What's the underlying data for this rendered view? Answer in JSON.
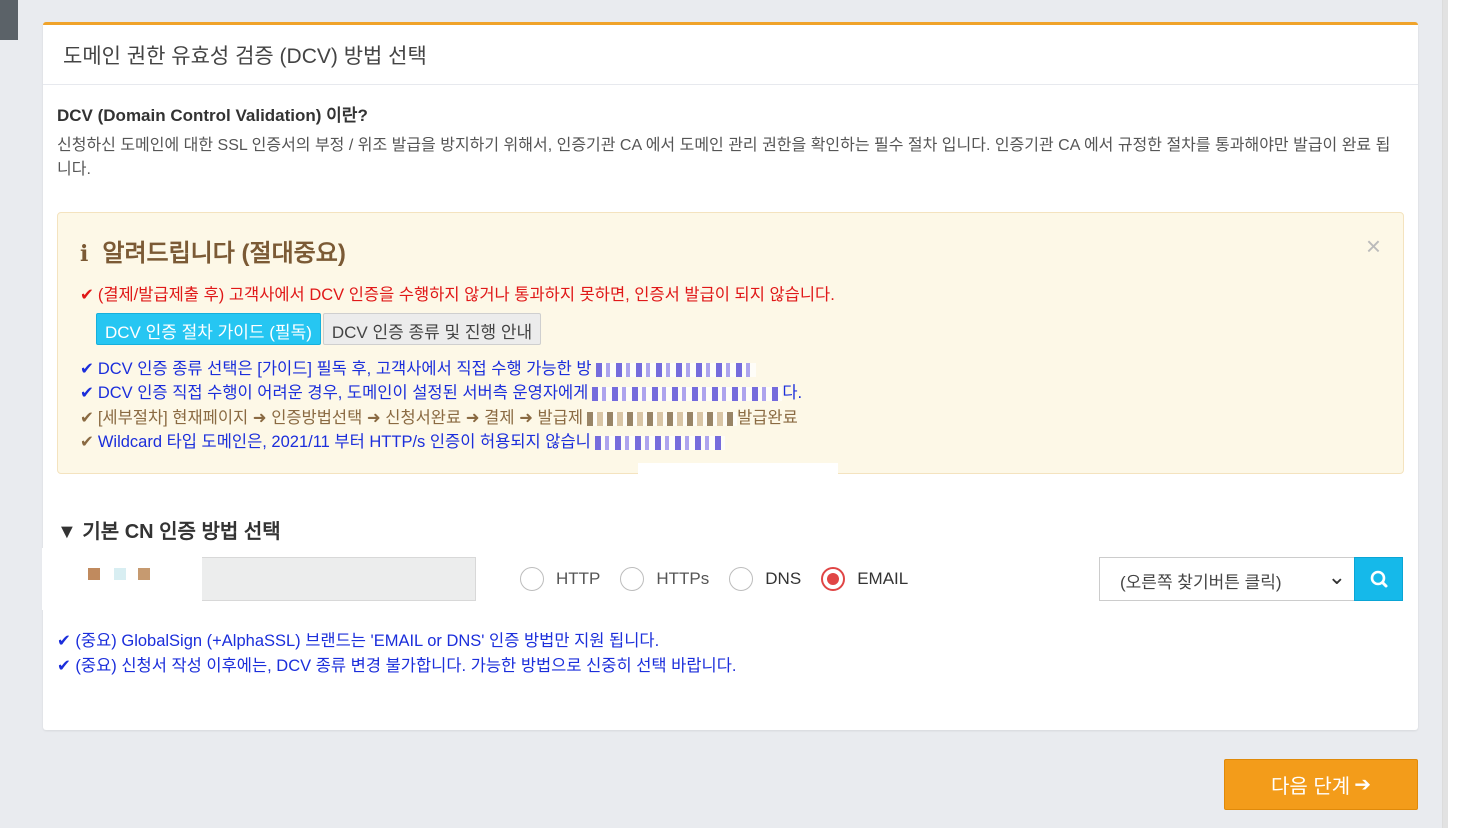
{
  "section": {
    "title": "도메인 권한 유효성 검증 (DCV) 방법 선택",
    "dcv_question": "DCV (Domain Control Validation) 이란?",
    "dcv_description": "신청하신 도메인에 대한 SSL 인증서의 부정 / 위조 발급을 방지하기 위해서, 인증기관 CA 에서 도메인 관리 권한을 확인하는 필수 절차 입니다. 인증기관 CA 에서 규정한 절차를 통과해야만 발급이 완료 됩니다."
  },
  "notice": {
    "title": "알려드립니다 (절대중요)",
    "close": "×",
    "line1": "(결제/발급제출 후) 고객사에서 DCV 인증을 수행하지 않거나 통과하지 못하면, 인증서 발급이 되지 않습니다.",
    "guide_button": "DCV 인증 절차 가이드 (필독)",
    "types_button": "DCV 인증 종류 및 진행 안내",
    "line2": "DCV 인증 종류 선택은 [가이드] 필독 후, 고객사에서 직접 수행 가능한 방",
    "line3": "DCV 인증 직접 수행이 어려운 경우, 도메인이 설정된 서버측 운영자에게",
    "line3_end": "다.",
    "line4": "[세부절차] 현재페이지 ➜ 인증방법선택 ➜ 신청서완료 ➜ 결제 ➜ 발급제",
    "line4_end": "발급완료",
    "line5": "Wildcard 타입 도메인은, 2021/11 부터 HTTP/s 인증이 허용되지 않습니"
  },
  "cn": {
    "title": "▼ 기본 CN 인증 방법 선택",
    "methods": [
      "HTTP",
      "HTTPs",
      "DNS",
      "EMAIL"
    ],
    "selected": "EMAIL",
    "select_value": "(오른쪽 찾기버튼 클릭)"
  },
  "notes": [
    "(중요) GlobalSign (+AlphaSSL) 브랜드는 'EMAIL or DNS' 인증 방법만 지원 됩니다.",
    "(중요) 신청서 작성 이후에는, DCV 종류 변경 불가합니다. 가능한 방법으로 신중히 선택 바랍니다."
  ],
  "next_button": "다음 단계",
  "colors": {
    "accent": "#f39c1a",
    "notice_red": "#e01818",
    "notice_blue": "#1b2edb",
    "cyan": "#26c6f2"
  }
}
